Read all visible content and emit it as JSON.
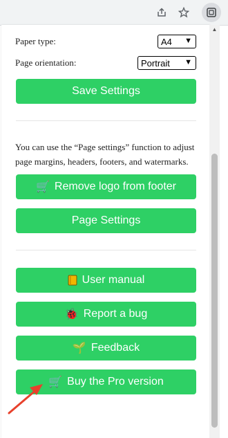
{
  "browser": {
    "icons": [
      "share-icon",
      "star-icon",
      "extension-icon"
    ]
  },
  "settings": {
    "paper_type_label": "Paper type:",
    "paper_type_value": "A4",
    "orientation_label": "Page orientation:",
    "orientation_value": "Portrait",
    "save_label": "Save Settings"
  },
  "info_text": "You can use the “Page settings” function to adjust page margins, headers, footers, and watermarks.",
  "buttons": {
    "remove_logo": "Remove logo from footer",
    "page_settings": "Page Settings",
    "user_manual": "User manual",
    "report_bug": "Report a bug",
    "feedback": "Feedback",
    "buy_pro": "Buy the Pro version"
  },
  "colors": {
    "button_green": "#2ed065",
    "arrow_red": "#e8412c"
  }
}
